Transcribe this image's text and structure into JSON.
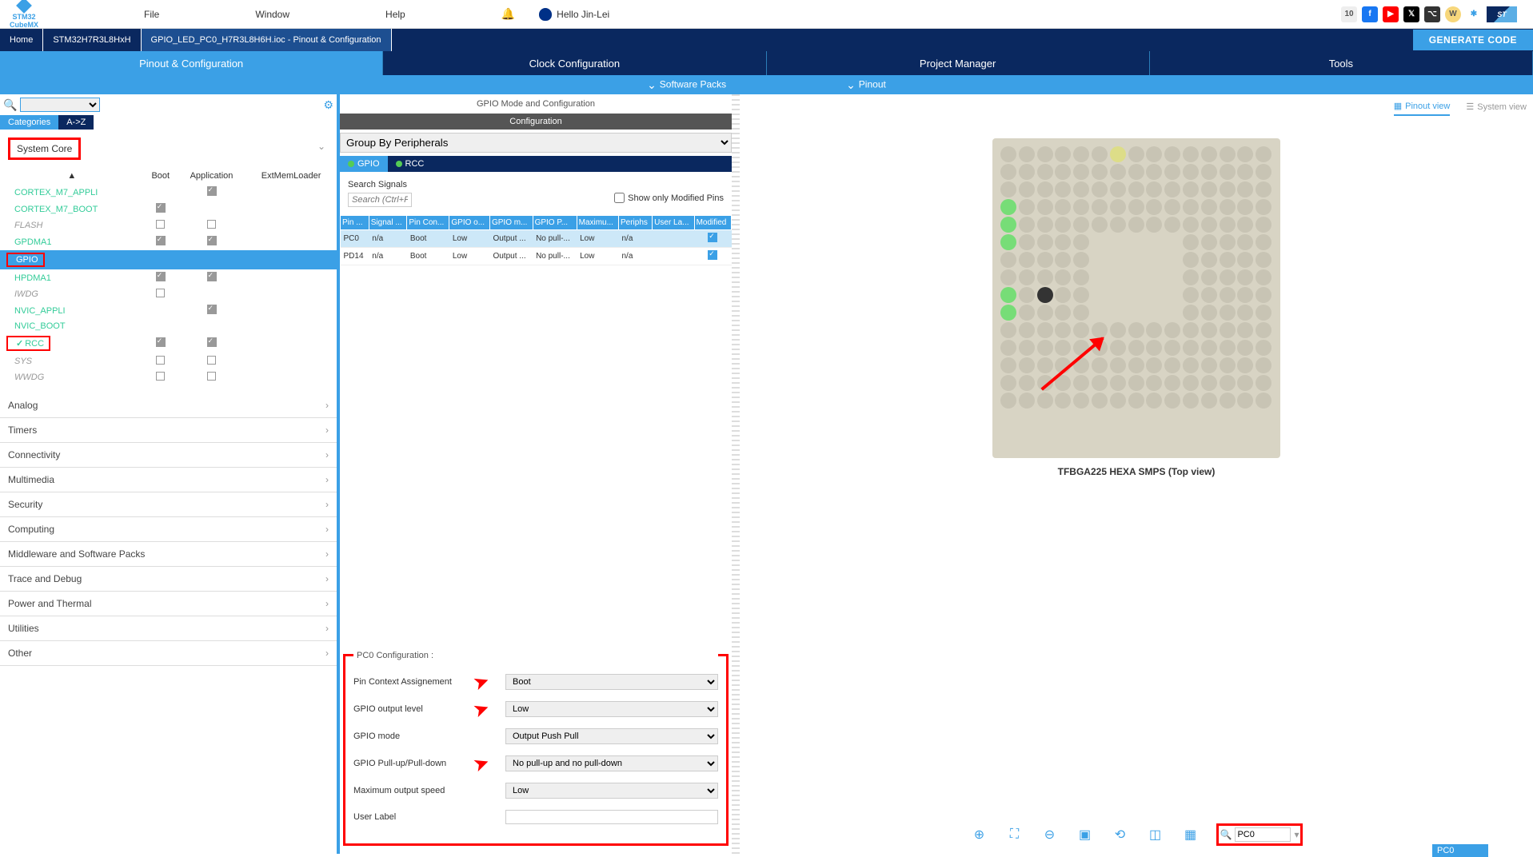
{
  "app": {
    "logo_top": "STM32",
    "logo_bottom": "CubeMX"
  },
  "menu": {
    "file": "File",
    "window": "Window",
    "help": "Help",
    "user_greeting": "Hello Jin-Lei"
  },
  "breadcrumb": {
    "home": "Home",
    "device": "STM32H7R3L8HxH",
    "project": "GPIO_LED_PC0_H7R3L8H6H.ioc - Pinout & Configuration",
    "generate": "GENERATE CODE"
  },
  "main_tabs": {
    "pinout": "Pinout & Configuration",
    "clock": "Clock Configuration",
    "project": "Project Manager",
    "tools": "Tools"
  },
  "sub_tabs": {
    "software": "Software Packs",
    "pinout": "Pinout"
  },
  "left": {
    "view_categories": "Categories",
    "view_az": "A->Z",
    "system_core": "System Core",
    "headers": {
      "boot": "Boot",
      "application": "Application",
      "extmem": "ExtMemLoader"
    },
    "periphs": [
      {
        "name": "CORTEX_M7_APPLI",
        "boot": "",
        "app": "f",
        "ext": ""
      },
      {
        "name": "CORTEX_M7_BOOT",
        "boot": "f",
        "app": "",
        "ext": ""
      },
      {
        "name": "FLASH",
        "gray": true,
        "boot": "e",
        "app": "e",
        "ext": ""
      },
      {
        "name": "GPDMA1",
        "boot": "f",
        "app": "f",
        "ext": ""
      },
      {
        "name": "GPIO",
        "selected": true,
        "redbox": true
      },
      {
        "name": "HPDMA1",
        "boot": "f",
        "app": "f",
        "ext": ""
      },
      {
        "name": "IWDG",
        "gray": true,
        "boot": "e",
        "app": "",
        "ext": ""
      },
      {
        "name": "NVIC_APPLI",
        "boot": "",
        "app": "f",
        "ext": ""
      },
      {
        "name": "NVIC_BOOT"
      },
      {
        "name": "RCC",
        "checked": true,
        "redbox": true,
        "boot": "f",
        "app": "f",
        "ext": ""
      },
      {
        "name": "SYS",
        "gray": true,
        "boot": "e",
        "app": "e",
        "ext": ""
      },
      {
        "name": "WWDG",
        "gray": true,
        "boot": "e",
        "app": "e",
        "ext": ""
      }
    ],
    "categories": [
      "Analog",
      "Timers",
      "Connectivity",
      "Multimedia",
      "Security",
      "Computing",
      "Middleware and Software Packs",
      "Trace and Debug",
      "Power and Thermal",
      "Utilities",
      "Other"
    ]
  },
  "mid": {
    "header": "GPIO Mode and Configuration",
    "config_bar": "Configuration",
    "group_by": "Group By Peripherals",
    "gpio_tab": "GPIO",
    "rcc_tab": "RCC",
    "search_label": "Search Signals",
    "search_placeholder": "Search (Ctrl+F)",
    "show_modified": "Show only Modified Pins",
    "table_headers": [
      "Pin ...",
      "Signal ...",
      "Pin Con...",
      "GPIO o...",
      "GPIO m...",
      "GPIO P...",
      "Maximu...",
      "Periphs",
      "User La...",
      "Modified"
    ],
    "rows": [
      {
        "pin": "PC0",
        "signal": "n/a",
        "context": "Boot",
        "out": "Low",
        "mode": "Output ...",
        "pull": "No pull-...",
        "max": "Low",
        "periph": "n/a",
        "label": "",
        "mod": true,
        "sel": true
      },
      {
        "pin": "PD14",
        "signal": "n/a",
        "context": "Boot",
        "out": "Low",
        "mode": "Output ...",
        "pull": "No pull-...",
        "max": "Low",
        "periph": "n/a",
        "label": "",
        "mod": true
      }
    ],
    "fieldset_title": "PC0 Configuration :",
    "fields": {
      "pin_context": {
        "label": "Pin Context Assignement",
        "value": "Boot",
        "arrow": true
      },
      "output_level": {
        "label": "GPIO output level",
        "value": "Low",
        "arrow": true
      },
      "mode": {
        "label": "GPIO mode",
        "value": "Output Push Pull"
      },
      "pull": {
        "label": "GPIO Pull-up/Pull-down",
        "value": "No pull-up and no pull-down",
        "arrow": true
      },
      "speed": {
        "label": "Maximum output speed",
        "value": "Low"
      },
      "user_label": {
        "label": "User Label",
        "value": ""
      }
    }
  },
  "right": {
    "pinout_view": "Pinout view",
    "system_view": "System view",
    "chip_label": "TFBGA225 HEXA SMPS (Top view)",
    "search_value": "PC0",
    "search_suggest": "PC0"
  }
}
